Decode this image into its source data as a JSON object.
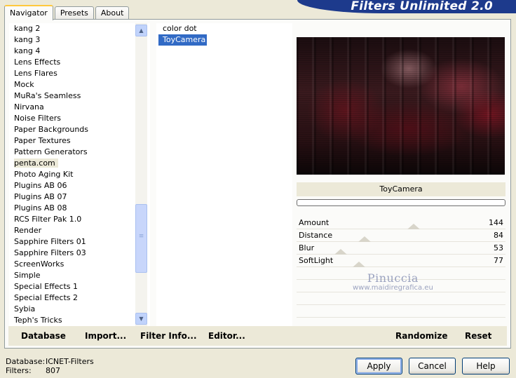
{
  "banner": {
    "title": "Filters Unlimited 2.0"
  },
  "tabs": [
    {
      "label": "Navigator",
      "active": true
    },
    {
      "label": "Presets",
      "active": false
    },
    {
      "label": "About",
      "active": false
    }
  ],
  "categories": {
    "items": [
      "kang 2",
      "kang 3",
      "kang 4",
      "Lens Effects",
      "Lens Flares",
      "Mock",
      "MuRa's Seamless",
      "Nirvana",
      "Noise Filters",
      "Paper Backgrounds",
      "Paper Textures",
      "Pattern Generators",
      "penta.com",
      "Photo Aging Kit",
      "Plugins AB 06",
      "Plugins AB 07",
      "Plugins AB 08",
      "RCS Filter Pak 1.0",
      "Render",
      "Sapphire Filters 01",
      "Sapphire Filters 03",
      "ScreenWorks",
      "Simple",
      "Special Effects 1",
      "Special Effects 2",
      "Sybia",
      "Teph's Tricks"
    ],
    "selected": "penta.com"
  },
  "scrollbar": {
    "up_icon": "arrow-up-icon",
    "down_icon": "arrow-down-icon",
    "grip": "≡"
  },
  "filters": {
    "items": [
      "color dot",
      "ToyCamera"
    ],
    "selected": "ToyCamera"
  },
  "filter_panel": {
    "name": "ToyCamera",
    "params": [
      {
        "name": "Amount",
        "value": "144"
      },
      {
        "name": "Distance",
        "value": "84"
      },
      {
        "name": "Blur",
        "value": "53"
      },
      {
        "name": "SoftLight",
        "value": "77"
      }
    ]
  },
  "watermark": {
    "line1": "Pinuccia",
    "line2": "www.maidiregrafica.eu"
  },
  "bottom_bar": {
    "database": "Database",
    "import": "Import...",
    "filter_info": "Filter Info...",
    "editor": "Editor...",
    "randomize": "Randomize",
    "reset": "Reset"
  },
  "status": {
    "database_label": "Database:",
    "database_value": "ICNET-Filters",
    "filters_label": "Filters:",
    "filters_value": "807"
  },
  "buttons": {
    "apply": "Apply",
    "cancel": "Cancel",
    "help": "Help"
  },
  "colors": {
    "banner": "#1d3a8c",
    "selection": "#316ac5",
    "panel": "#ece9d8"
  }
}
